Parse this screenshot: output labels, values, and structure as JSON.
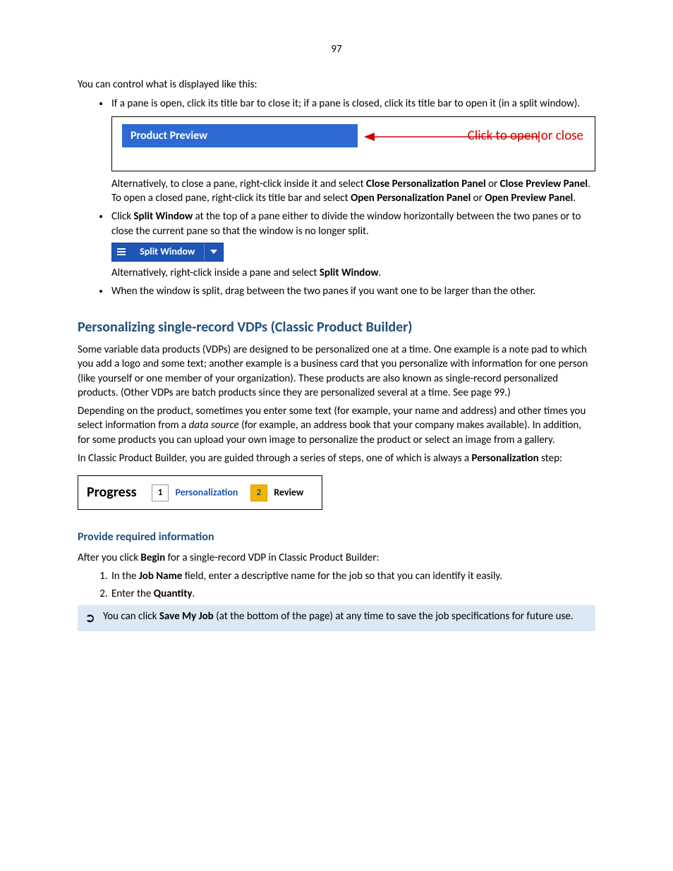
{
  "page_number": "97",
  "intro": "You can control what is displayed like this:",
  "b1_pre": "If a pane is open, click its title bar to close it; if a pane is closed, click its title bar to open it (in a split window).",
  "fig1_bar": "Product Preview",
  "fig1_callout": "Click to open or close",
  "b1_alt_1": "Alternatively, to close a pane, right-click inside it and select ",
  "b1_alt_bold1": "Close Personalization Panel",
  "b1_alt_or1": " or ",
  "b1_alt_bold2": "Close Preview Panel",
  "b1_alt_2": ". To open a closed pane, right-click its title bar and select ",
  "b1_alt_bold3": "Open Personalization Panel",
  "b1_alt_or2": " or ",
  "b1_alt_bold4": "Open Preview Panel",
  "b1_alt_3": ".",
  "b2_pre": "Click ",
  "b2_bold": "Split Window",
  "b2_post": " at the top of a pane either to divide the window horizontally between the two panes or to close the current pane so that the window is no longer split.",
  "split_button_label": "Split Window",
  "b2_alt_1": "Alternatively, right-click inside a pane and select ",
  "b2_alt_bold": "Split Window",
  "b2_alt_2": ".",
  "b3": "When the window is split, drag between the two panes if you want one to be larger than the other.",
  "h2": "Personalizing single-record VDPs (Classic Product Builder)",
  "p1": "Some variable data products (VDPs) are designed to be personalized one at a time. One example is a note pad to which you add a logo and some text; another example is a business card that you personalize with information for one person (like yourself or one member of your organization). These products are also known as single-record personalized products. (Other VDPs are batch products since they are personalized several at a time. See page 99.)",
  "p2a": "Depending on the product, sometimes you enter some text (for example, your name and address) and other times you select information from a ",
  "p2_em": "data source",
  "p2b": " (for example, an address book that your company makes available). In addition, for some products you can upload your own image to personalize the product or select an image from a gallery.",
  "p3a": "In Classic Product Builder, you are guided through a series of steps, one of which is always a ",
  "p3_bold": "Personalization",
  "p3b": " step:",
  "progress_label": "Progress",
  "step1_num": "1",
  "step1_name": "Personalization",
  "step2_num": "2",
  "step2_name": "Review",
  "h3": "Provide required information",
  "p4a": "After you click ",
  "p4_bold": "Begin",
  "p4b": " for a single-record VDP in Classic Product Builder:",
  "s1a": "In the ",
  "s1_bold": "Job Name",
  "s1b": " field, enter a descriptive name for the job so that you can identify it easily.",
  "s2a": "Enter the ",
  "s2_bold": "Quantity",
  "s2b": ".",
  "tip_a": "You can click ",
  "tip_bold": "Save My Job",
  "tip_b": " (at the bottom of the page) at any time to save the job specifications for future use."
}
